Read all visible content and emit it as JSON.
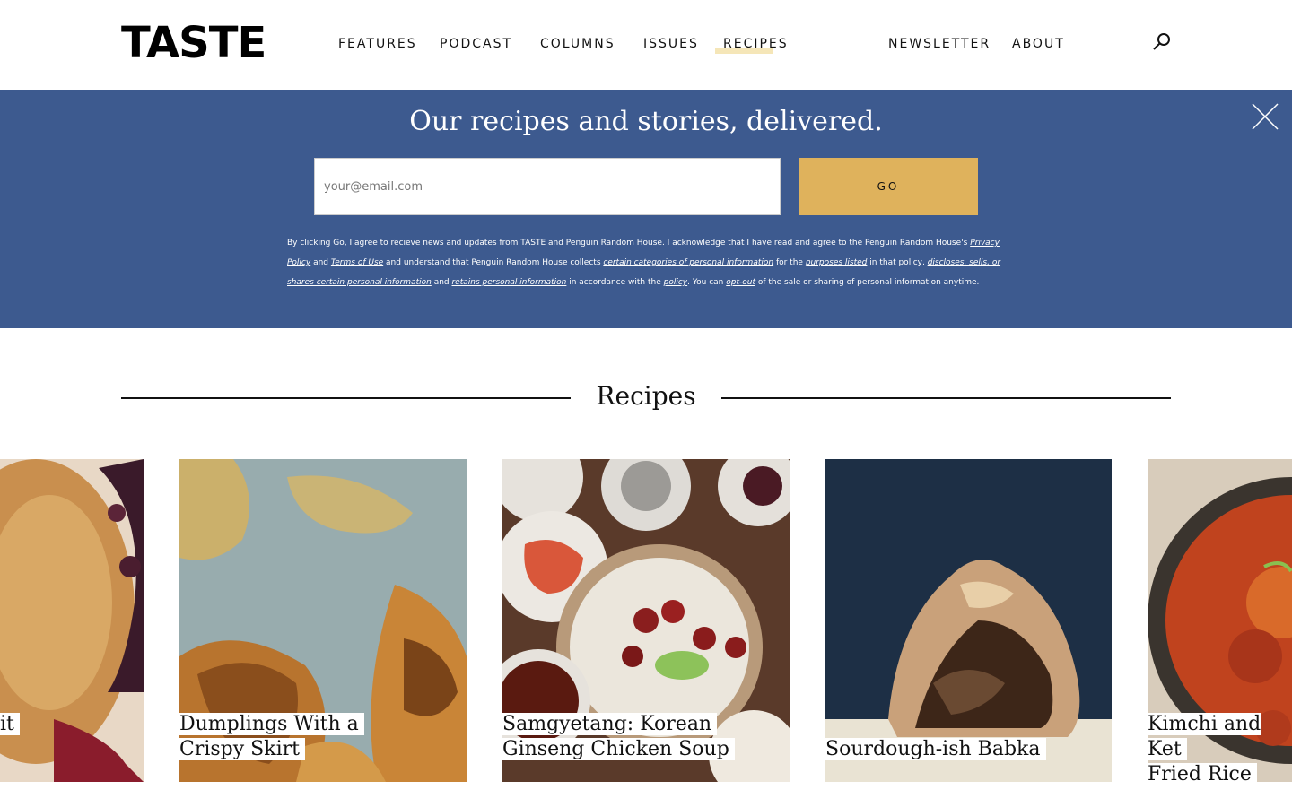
{
  "header": {
    "logo": "TASTE",
    "nav": [
      {
        "label": "FEATURES"
      },
      {
        "label": "PODCAST"
      },
      {
        "label": "COLUMNS"
      },
      {
        "label": "ISSUES"
      },
      {
        "label": "RECIPES"
      },
      {
        "label": "NEWSLETTER"
      },
      {
        "label": "ABOUT"
      }
    ],
    "active_nav": "RECIPES"
  },
  "newsletter": {
    "title": "Our recipes and stories, delivered.",
    "email_placeholder": "your@email.com",
    "go_label": "GO",
    "legal": {
      "t1": "By clicking Go, I agree to recieve news and updates from TASTE and Penguin Random House. I acknowledge that I have read and agree to the Penguin Random House's ",
      "privacy": "Privacy Policy",
      "t2": " and ",
      "terms": "Terms of Use",
      "t3": " and understand that Penguin Random House collects ",
      "categories": "certain categories of personal information",
      "t4": " for the ",
      "purposes": "purposes listed",
      "t5": " in that policy, ",
      "discloses": "discloses, sells, or shares certain personal information",
      "t6": " and ",
      "retains": "retains personal information",
      "t7": " in accordance with the ",
      "policy": "policy",
      "t8": ". You can ",
      "optout": "opt-out",
      "t9": " of the sale or sharing of personal information anytime."
    }
  },
  "recipes": {
    "heading": "Recipes",
    "cards": [
      {
        "title_line1": "it",
        "title_line2": ""
      },
      {
        "title_line1": "Dumplings With a",
        "title_line2": "Crispy Skirt"
      },
      {
        "title_line1": "Samgyetang: Korean",
        "title_line2": "Ginseng Chicken Soup"
      },
      {
        "title_line1": "",
        "title_line2": "Sourdough-ish Babka"
      },
      {
        "title_line1": "Kimchi and Ket",
        "title_line2": "Fried Rice"
      }
    ]
  },
  "colors": {
    "banner": "#3d5a8f",
    "go_button": "#dfb25c",
    "active_underline": "#f5e6b8"
  },
  "icons": [
    "search-icon",
    "close-icon"
  ]
}
